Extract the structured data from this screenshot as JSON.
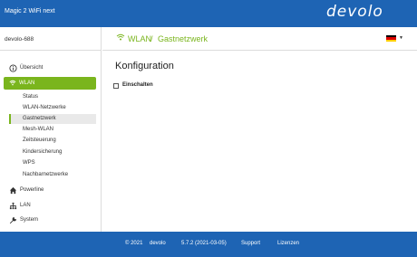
{
  "header": {
    "product_name": "Magic 2 WiFi next",
    "logo_text": "devolo"
  },
  "device": {
    "name": "devolo-688"
  },
  "sidebar": {
    "items": [
      {
        "label": "Übersicht",
        "icon": "info-circle-icon"
      },
      {
        "label": "WLAN",
        "icon": "wifi-icon",
        "active": true
      },
      {
        "label": "Powerline",
        "icon": "home-icon"
      },
      {
        "label": "LAN",
        "icon": "network-icon"
      },
      {
        "label": "System",
        "icon": "wrench-icon"
      }
    ],
    "wlan_subitems": [
      {
        "label": "Status"
      },
      {
        "label": "WLAN-Netzwerke"
      },
      {
        "label": "Gastnetzwerk",
        "active": true
      },
      {
        "label": "Mesh-WLAN"
      },
      {
        "label": "Zeitsteuerung"
      },
      {
        "label": "Kindersicherung"
      },
      {
        "label": "WPS"
      },
      {
        "label": "Nachbarnetzwerke"
      }
    ]
  },
  "breadcrumb": {
    "section": "WLAN",
    "separator": "/",
    "page": "Gastnetzwerk"
  },
  "language": {
    "flag": "de-flag-icon",
    "colors": [
      "#000000",
      "#dd0000",
      "#ffce00"
    ]
  },
  "content": {
    "title": "Konfiguration",
    "checkbox_label": "Einschalten",
    "checkbox_checked": false
  },
  "footer": {
    "copyright": "© 2021",
    "brand": "devolo",
    "version": "5.7.2 (2021-03-05)",
    "support": "Support",
    "licenses": "Lizenzen"
  },
  "colors": {
    "brand_blue": "#1e64b4",
    "accent_green": "#7ab51d"
  }
}
